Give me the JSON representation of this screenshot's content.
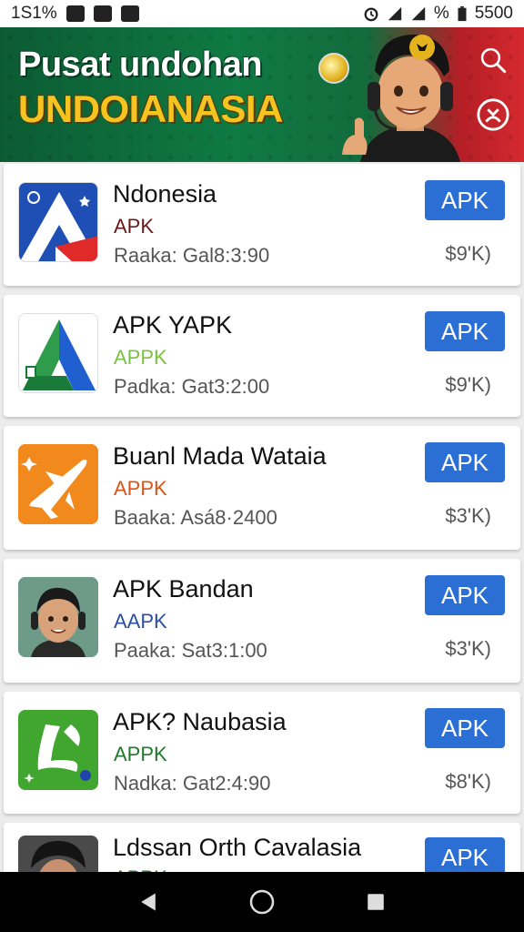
{
  "status_bar": {
    "left_text": "1S1%",
    "right_text": "5500",
    "battery_text": "%"
  },
  "hero": {
    "title": "Pusat undohan",
    "subtitle": "UNDOIANASIA"
  },
  "apps": [
    {
      "name": "Ndonesia",
      "type": "APK",
      "type_color": "#6b1a1a",
      "meta": "Raaka: Gal8:3:90",
      "button": "APK",
      "size": "$9'K)",
      "icon": "flag-arrow-icon"
    },
    {
      "name": "APK YAPK",
      "type": "APPK",
      "type_color": "#7cc241",
      "meta": "Padka: Gat3:2:00",
      "button": "APK",
      "size": "$9'K)",
      "icon": "triangle-a-icon"
    },
    {
      "name": "Buanl Mada Wataia",
      "type": "APPK",
      "type_color": "#d9541a",
      "meta": "Baaka: Asá8·2400",
      "button": "APK",
      "size": "$3'K)",
      "icon": "plane-icon"
    },
    {
      "name": "APK Bandan",
      "type": "AAPK",
      "type_color": "#2a4fa0",
      "meta": "Paaka: Sat3:1:00",
      "button": "APK",
      "size": "$3'K)",
      "icon": "avatar-headset-icon"
    },
    {
      "name": "APK? Naubasia",
      "type": "APPK",
      "type_color": "#1f7a2e",
      "meta": "Nadka: Gat2:4:90",
      "button": "APK",
      "size": "$8'K)",
      "icon": "green-l-icon"
    },
    {
      "name": "Ldssan Orth Cavalasia",
      "type": "APPK",
      "type_color": "#1f7a2e",
      "meta": "",
      "button": "APK",
      "size": "",
      "icon": "avatar-man-icon"
    }
  ]
}
